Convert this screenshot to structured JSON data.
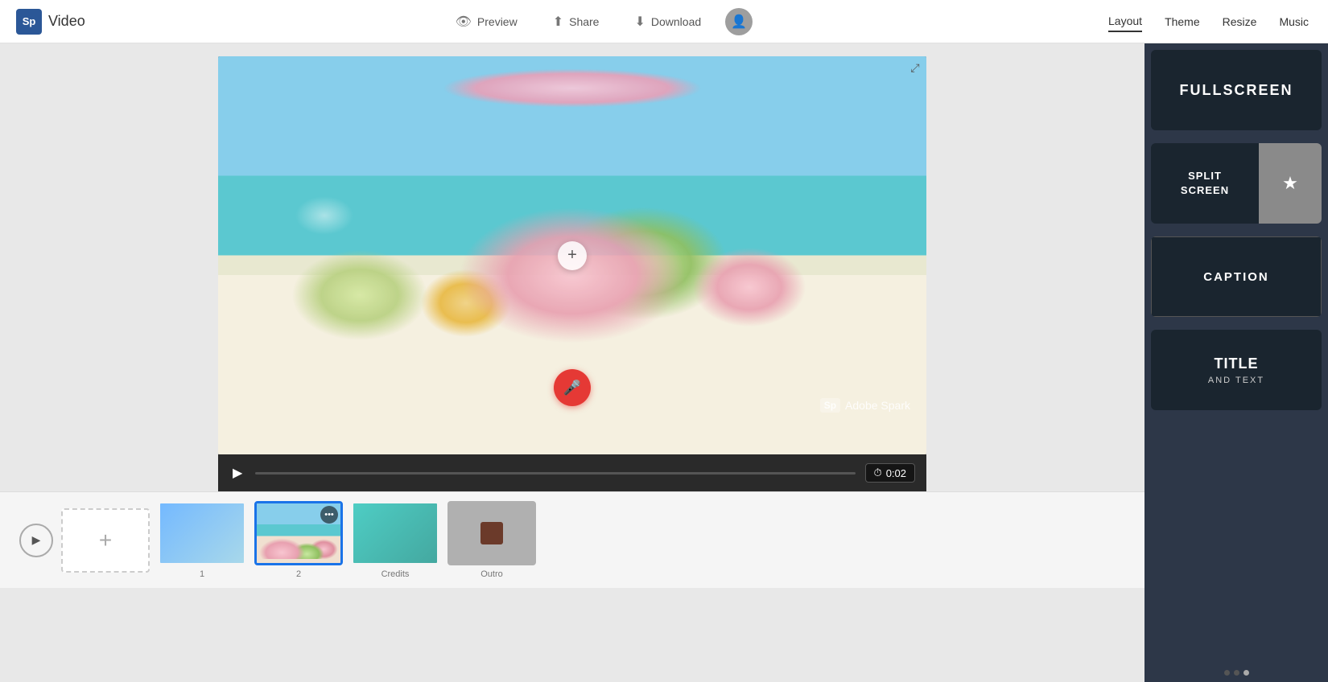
{
  "app": {
    "logo_text": "Sp",
    "app_name": "Video"
  },
  "header": {
    "preview_label": "Preview",
    "share_label": "Share",
    "download_label": "Download",
    "layout_label": "Layout",
    "theme_label": "Theme",
    "resize_label": "Resize",
    "music_label": "Music"
  },
  "player": {
    "time": "0:02",
    "add_icon": "+",
    "watermark_sp": "Sp",
    "watermark_text": "Adobe Spark"
  },
  "timeline": {
    "play_icon": "▶",
    "add_icon": "+",
    "items": [
      {
        "id": "1",
        "type": "blue",
        "number": "1"
      },
      {
        "id": "2",
        "type": "flower",
        "number": "2",
        "active": true
      },
      {
        "id": "credits",
        "type": "teal",
        "label": "Credits"
      },
      {
        "id": "outro",
        "type": "outro",
        "label": "Outro"
      }
    ]
  },
  "right_panel": {
    "fullscreen_label": "FULLSCREEN",
    "split_left_label": "SPLIT\nSCREEN",
    "split_star_icon": "★",
    "caption_label": "CAPTION",
    "title_main": "TITLE",
    "title_sub": "AND TEXT",
    "dots": [
      false,
      false,
      true
    ]
  }
}
